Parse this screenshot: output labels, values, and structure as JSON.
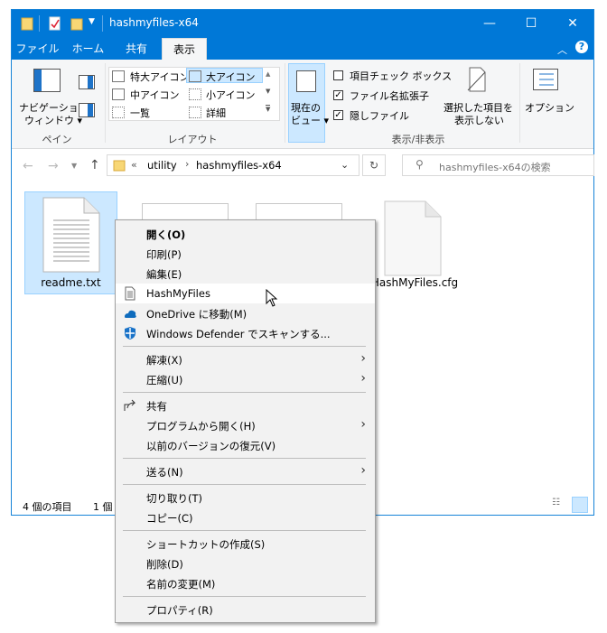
{
  "window": {
    "title": "hashmyfiles-x64",
    "min_glyph": "—",
    "max_glyph": "☐",
    "close_glyph": "✕"
  },
  "tabs": [
    {
      "label": "ファイル"
    },
    {
      "label": "ホーム"
    },
    {
      "label": "共有"
    },
    {
      "label": "表示"
    }
  ],
  "ribbon": {
    "pane": {
      "nav_line1": "ナビゲーション",
      "nav_line2": "ウィンドウ ▾",
      "group": "ペイン"
    },
    "layout": {
      "items": [
        "特大アイコン",
        "大アイコン",
        "中アイコン",
        "小アイコン",
        "一覧",
        "詳細"
      ],
      "group": "レイアウト"
    },
    "current_view": {
      "line1": "現在の",
      "line2": "ビュー ▾"
    },
    "show_hide": {
      "item_checkbox": "項目チェック ボックス",
      "ext": "ファイル名拡張子",
      "hidden": "隠しファイル",
      "hide_selected_line1": "選択した項目を",
      "hide_selected_line2": "表示しない",
      "group": "表示/非表示"
    },
    "options": "オプション"
  },
  "address": {
    "chevrons": "«",
    "crumb1": "utility",
    "crumb2": "hashmyfiles-x64",
    "search_placeholder": "hashmyfiles-x64の検索"
  },
  "files": [
    {
      "name": "readme.txt",
      "selected": true
    },
    {
      "name": "HashMyFiles.cfg",
      "selected": false
    }
  ],
  "status": {
    "count": "4 個の項目",
    "selected": "1 個"
  },
  "context_menu": [
    {
      "label": "開く(O)",
      "bold": true
    },
    {
      "label": "印刷(P)"
    },
    {
      "label": "編集(E)"
    },
    {
      "label": "HashMyFiles",
      "icon": "document-icon",
      "hover": true
    },
    {
      "label": "OneDrive に移動(M)",
      "icon": "onedrive-cloud-icon"
    },
    {
      "label": "Windows Defender でスキャンする...",
      "icon": "defender-shield-icon"
    },
    {
      "label": "解凍(X)",
      "submenu": true
    },
    {
      "label": "圧縮(U)",
      "submenu": true
    },
    {
      "label": "共有",
      "icon": "share-icon"
    },
    {
      "label": "プログラムから開く(H)",
      "submenu": true
    },
    {
      "label": "以前のバージョンの復元(V)"
    },
    {
      "label": "送る(N)",
      "submenu": true
    },
    {
      "label": "切り取り(T)"
    },
    {
      "label": "コピー(C)"
    },
    {
      "label": "ショートカットの作成(S)"
    },
    {
      "label": "削除(D)"
    },
    {
      "label": "名前の変更(M)"
    },
    {
      "label": "プロパティ(R)"
    }
  ],
  "colors": {
    "accent": "#0078d7",
    "selection": "#cce8ff"
  }
}
